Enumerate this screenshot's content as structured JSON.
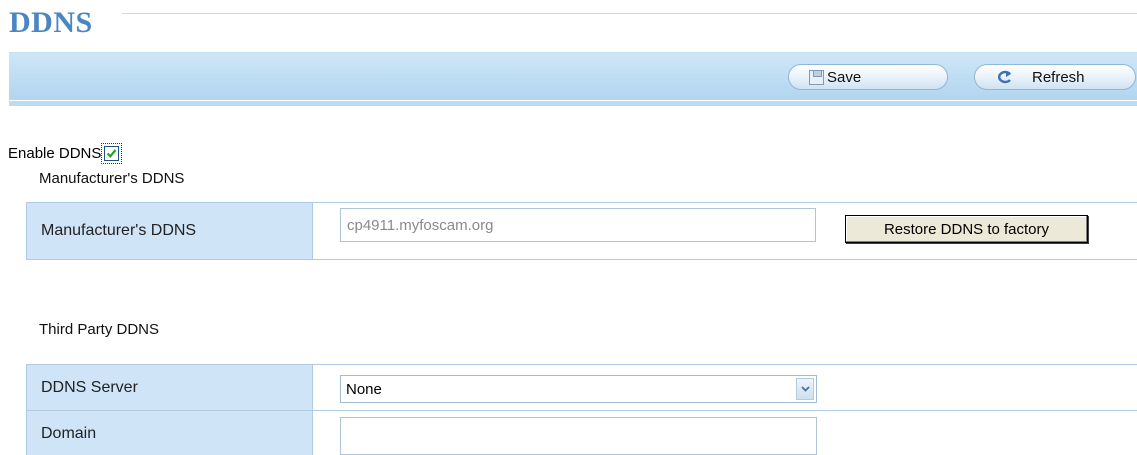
{
  "page": {
    "title": "DDNS"
  },
  "toolbar": {
    "save_label": "Save",
    "refresh_label": "Refresh"
  },
  "enable": {
    "label": "Enable DDNS",
    "checked": true
  },
  "manufacturer": {
    "section_title": "Manufacturer's DDNS",
    "field_label": "Manufacturer's DDNS",
    "value": "cp4911.myfoscam.org",
    "restore_label": "Restore DDNS to factory"
  },
  "third_party": {
    "section_title": "Third Party DDNS",
    "server_label": "DDNS Server",
    "server_value": "None",
    "domain_label": "Domain",
    "domain_value": ""
  },
  "colors": {
    "title": "#4a86c2",
    "toolbar": "#bcdcf2",
    "label_cell": "#cfe4f6"
  },
  "icons": {
    "save": "save-icon",
    "refresh": "refresh-icon",
    "checkbox": "checkmark-icon",
    "dropdown": "chevron-down-icon"
  }
}
